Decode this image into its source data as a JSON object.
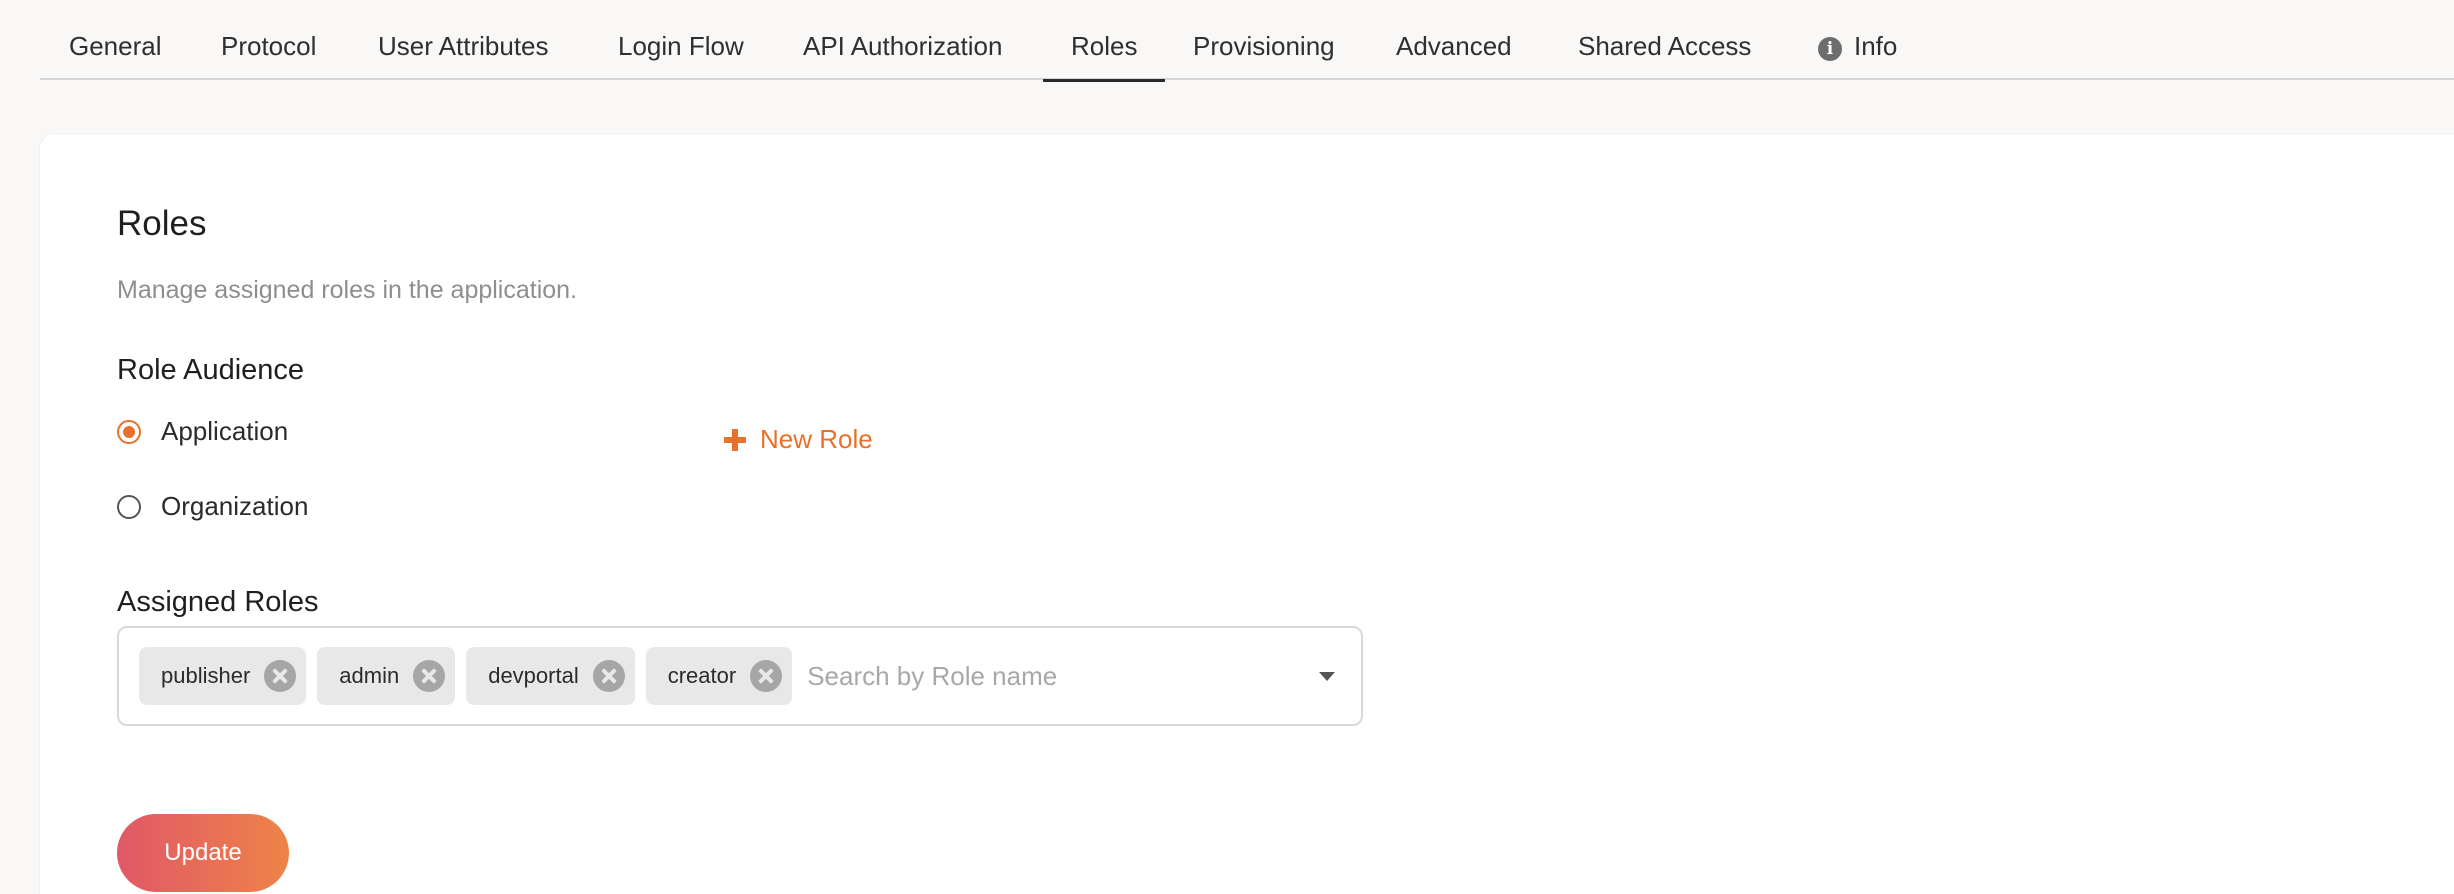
{
  "tabs": [
    {
      "label": "General"
    },
    {
      "label": "Protocol"
    },
    {
      "label": "User Attributes"
    },
    {
      "label": "Login Flow"
    },
    {
      "label": "API Authorization"
    },
    {
      "label": "Roles",
      "active": true
    },
    {
      "label": "Provisioning"
    },
    {
      "label": "Advanced"
    },
    {
      "label": "Shared Access"
    },
    {
      "label": "Info",
      "icon": "info-icon"
    }
  ],
  "roles": {
    "title": "Roles",
    "description": "Manage assigned roles in the application.",
    "audience_label": "Role Audience",
    "audience_options": [
      {
        "label": "Application",
        "checked": true
      },
      {
        "label": "Organization",
        "checked": false
      }
    ],
    "new_role_label": "New Role",
    "assigned_label": "Assigned Roles",
    "assigned_roles": [
      "publisher",
      "admin",
      "devportal",
      "creator"
    ],
    "search_placeholder": "Search by Role name",
    "update_label": "Update"
  },
  "colors": {
    "accent": "#e8702a",
    "button_gradient_start": "#e05868",
    "button_gradient_end": "#ee8347"
  }
}
